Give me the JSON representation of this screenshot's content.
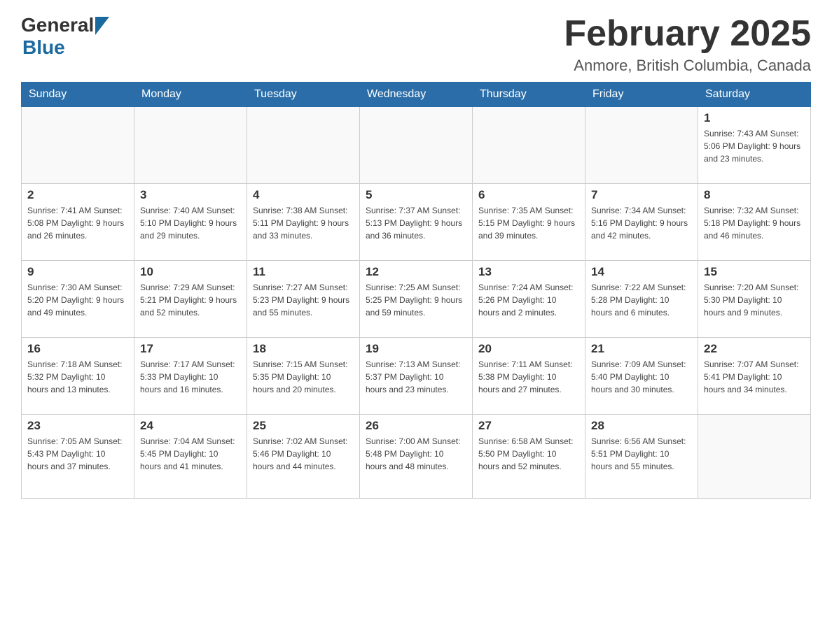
{
  "header": {
    "logo_general": "General",
    "logo_blue": "Blue",
    "month_title": "February 2025",
    "location": "Anmore, British Columbia, Canada"
  },
  "weekdays": [
    "Sunday",
    "Monday",
    "Tuesday",
    "Wednesday",
    "Thursday",
    "Friday",
    "Saturday"
  ],
  "weeks": [
    [
      {
        "day": "",
        "info": ""
      },
      {
        "day": "",
        "info": ""
      },
      {
        "day": "",
        "info": ""
      },
      {
        "day": "",
        "info": ""
      },
      {
        "day": "",
        "info": ""
      },
      {
        "day": "",
        "info": ""
      },
      {
        "day": "1",
        "info": "Sunrise: 7:43 AM\nSunset: 5:06 PM\nDaylight: 9 hours and 23 minutes."
      }
    ],
    [
      {
        "day": "2",
        "info": "Sunrise: 7:41 AM\nSunset: 5:08 PM\nDaylight: 9 hours and 26 minutes."
      },
      {
        "day": "3",
        "info": "Sunrise: 7:40 AM\nSunset: 5:10 PM\nDaylight: 9 hours and 29 minutes."
      },
      {
        "day": "4",
        "info": "Sunrise: 7:38 AM\nSunset: 5:11 PM\nDaylight: 9 hours and 33 minutes."
      },
      {
        "day": "5",
        "info": "Sunrise: 7:37 AM\nSunset: 5:13 PM\nDaylight: 9 hours and 36 minutes."
      },
      {
        "day": "6",
        "info": "Sunrise: 7:35 AM\nSunset: 5:15 PM\nDaylight: 9 hours and 39 minutes."
      },
      {
        "day": "7",
        "info": "Sunrise: 7:34 AM\nSunset: 5:16 PM\nDaylight: 9 hours and 42 minutes."
      },
      {
        "day": "8",
        "info": "Sunrise: 7:32 AM\nSunset: 5:18 PM\nDaylight: 9 hours and 46 minutes."
      }
    ],
    [
      {
        "day": "9",
        "info": "Sunrise: 7:30 AM\nSunset: 5:20 PM\nDaylight: 9 hours and 49 minutes."
      },
      {
        "day": "10",
        "info": "Sunrise: 7:29 AM\nSunset: 5:21 PM\nDaylight: 9 hours and 52 minutes."
      },
      {
        "day": "11",
        "info": "Sunrise: 7:27 AM\nSunset: 5:23 PM\nDaylight: 9 hours and 55 minutes."
      },
      {
        "day": "12",
        "info": "Sunrise: 7:25 AM\nSunset: 5:25 PM\nDaylight: 9 hours and 59 minutes."
      },
      {
        "day": "13",
        "info": "Sunrise: 7:24 AM\nSunset: 5:26 PM\nDaylight: 10 hours and 2 minutes."
      },
      {
        "day": "14",
        "info": "Sunrise: 7:22 AM\nSunset: 5:28 PM\nDaylight: 10 hours and 6 minutes."
      },
      {
        "day": "15",
        "info": "Sunrise: 7:20 AM\nSunset: 5:30 PM\nDaylight: 10 hours and 9 minutes."
      }
    ],
    [
      {
        "day": "16",
        "info": "Sunrise: 7:18 AM\nSunset: 5:32 PM\nDaylight: 10 hours and 13 minutes."
      },
      {
        "day": "17",
        "info": "Sunrise: 7:17 AM\nSunset: 5:33 PM\nDaylight: 10 hours and 16 minutes."
      },
      {
        "day": "18",
        "info": "Sunrise: 7:15 AM\nSunset: 5:35 PM\nDaylight: 10 hours and 20 minutes."
      },
      {
        "day": "19",
        "info": "Sunrise: 7:13 AM\nSunset: 5:37 PM\nDaylight: 10 hours and 23 minutes."
      },
      {
        "day": "20",
        "info": "Sunrise: 7:11 AM\nSunset: 5:38 PM\nDaylight: 10 hours and 27 minutes."
      },
      {
        "day": "21",
        "info": "Sunrise: 7:09 AM\nSunset: 5:40 PM\nDaylight: 10 hours and 30 minutes."
      },
      {
        "day": "22",
        "info": "Sunrise: 7:07 AM\nSunset: 5:41 PM\nDaylight: 10 hours and 34 minutes."
      }
    ],
    [
      {
        "day": "23",
        "info": "Sunrise: 7:05 AM\nSunset: 5:43 PM\nDaylight: 10 hours and 37 minutes."
      },
      {
        "day": "24",
        "info": "Sunrise: 7:04 AM\nSunset: 5:45 PM\nDaylight: 10 hours and 41 minutes."
      },
      {
        "day": "25",
        "info": "Sunrise: 7:02 AM\nSunset: 5:46 PM\nDaylight: 10 hours and 44 minutes."
      },
      {
        "day": "26",
        "info": "Sunrise: 7:00 AM\nSunset: 5:48 PM\nDaylight: 10 hours and 48 minutes."
      },
      {
        "day": "27",
        "info": "Sunrise: 6:58 AM\nSunset: 5:50 PM\nDaylight: 10 hours and 52 minutes."
      },
      {
        "day": "28",
        "info": "Sunrise: 6:56 AM\nSunset: 5:51 PM\nDaylight: 10 hours and 55 minutes."
      },
      {
        "day": "",
        "info": ""
      }
    ]
  ]
}
